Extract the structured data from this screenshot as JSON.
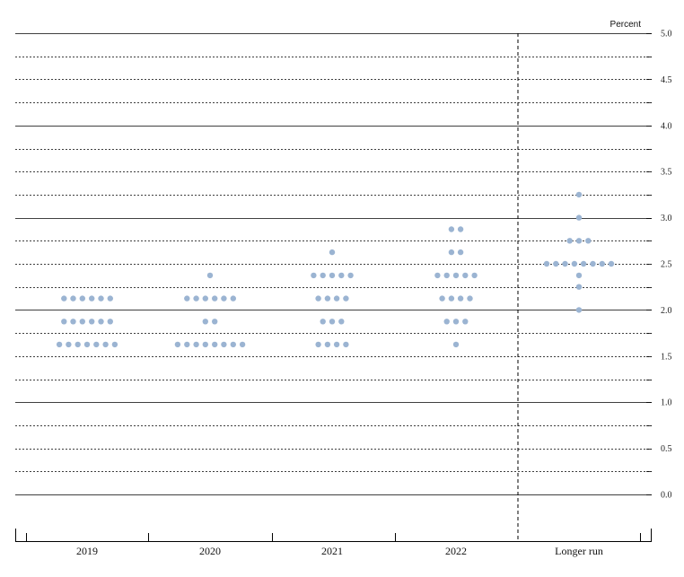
{
  "chart_data": {
    "type": "scatter",
    "unit_label": "Percent",
    "y_ticks": [
      "5.0",
      "4.5",
      "4.0",
      "3.5",
      "3.0",
      "2.5",
      "2.0",
      "1.5",
      "1.0",
      "0.5",
      "0.0"
    ],
    "ylim": [
      0,
      5
    ],
    "categories": [
      "2019",
      "2020",
      "2021",
      "2022",
      "Longer run"
    ],
    "dot_color": "#9bb4d2",
    "points": [
      {
        "category": "2019",
        "y": 2.125,
        "count": 6
      },
      {
        "category": "2019",
        "y": 1.875,
        "count": 6
      },
      {
        "category": "2019",
        "y": 1.625,
        "count": 7
      },
      {
        "category": "2020",
        "y": 2.375,
        "count": 1
      },
      {
        "category": "2020",
        "y": 2.125,
        "count": 6
      },
      {
        "category": "2020",
        "y": 1.875,
        "count": 2
      },
      {
        "category": "2020",
        "y": 1.625,
        "count": 8
      },
      {
        "category": "2021",
        "y": 2.625,
        "count": 1
      },
      {
        "category": "2021",
        "y": 2.375,
        "count": 5
      },
      {
        "category": "2021",
        "y": 2.125,
        "count": 4
      },
      {
        "category": "2021",
        "y": 1.875,
        "count": 3
      },
      {
        "category": "2021",
        "y": 1.625,
        "count": 4
      },
      {
        "category": "2022",
        "y": 2.875,
        "count": 2
      },
      {
        "category": "2022",
        "y": 2.625,
        "count": 2
      },
      {
        "category": "2022",
        "y": 2.375,
        "count": 5
      },
      {
        "category": "2022",
        "y": 2.125,
        "count": 4
      },
      {
        "category": "2022",
        "y": 1.875,
        "count": 3
      },
      {
        "category": "2022",
        "y": 1.625,
        "count": 1
      },
      {
        "category": "Longer run",
        "y": 3.25,
        "count": 1
      },
      {
        "category": "Longer run",
        "y": 3.0,
        "count": 1
      },
      {
        "category": "Longer run",
        "y": 2.75,
        "count": 3
      },
      {
        "category": "Longer run",
        "y": 2.5,
        "count": 8
      },
      {
        "category": "Longer run",
        "y": 2.375,
        "count": 1
      },
      {
        "category": "Longer run",
        "y": 2.25,
        "count": 1
      },
      {
        "category": "Longer run",
        "y": 2.0,
        "count": 1
      }
    ]
  }
}
